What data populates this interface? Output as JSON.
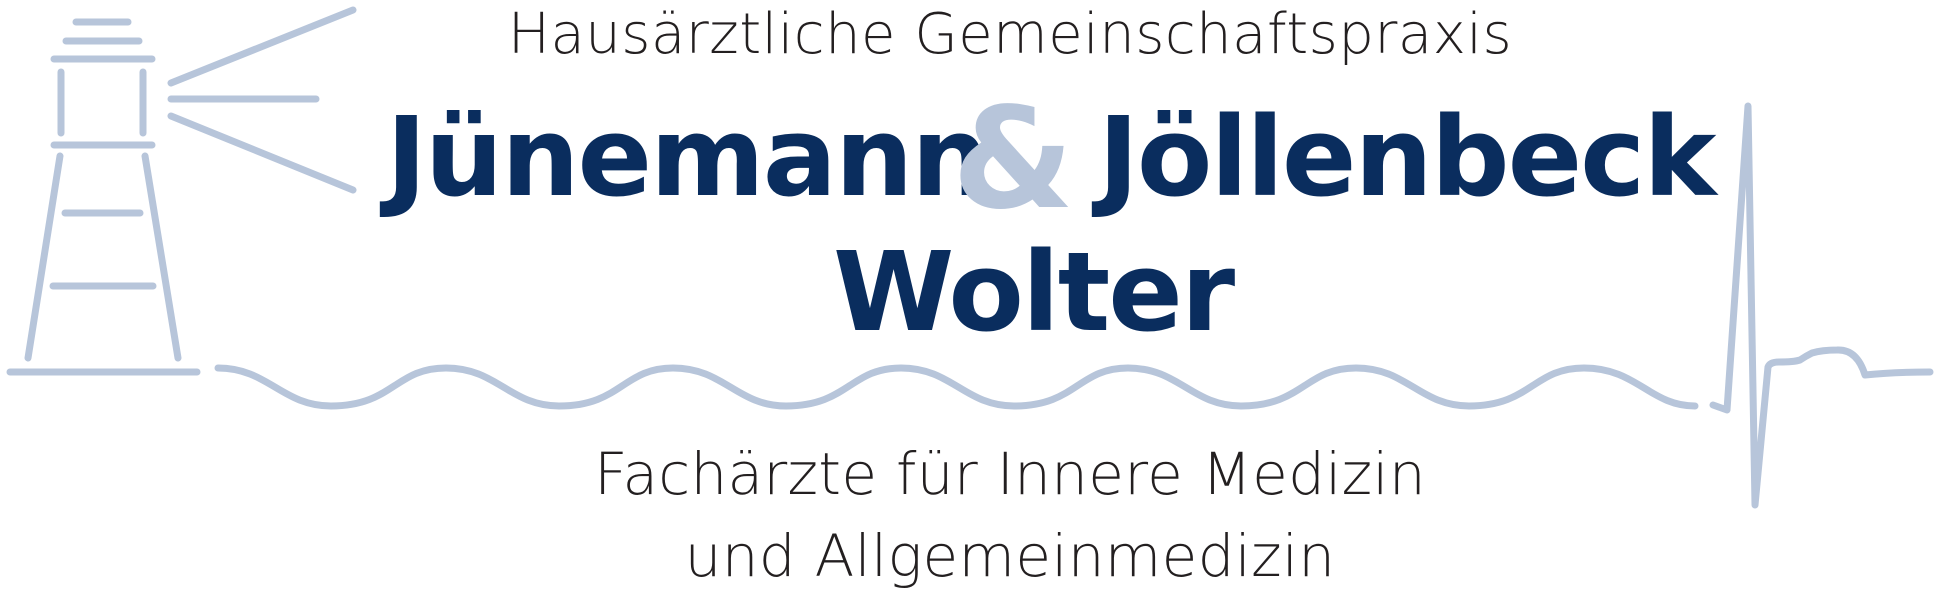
{
  "header": {
    "practice_type": "Hausärztliche Gemeinschaftspraxis"
  },
  "doctors": {
    "name_1": "Jünemann",
    "ampersand": "&",
    "name_2": "Jöllenbeck",
    "name_3": "Wolter"
  },
  "specialty": {
    "line_1": "Fachärzte für Innere Medizin",
    "line_2": "und Allgemeinmedizin"
  },
  "colors": {
    "navy": "#0a2d5e",
    "light_blue": "#b7c5da",
    "text_dark": "#231f20"
  },
  "graphics": {
    "left_icon": "lighthouse-icon",
    "wave": "sea-wave-line",
    "right_icon": "ecg-heartbeat-icon"
  }
}
